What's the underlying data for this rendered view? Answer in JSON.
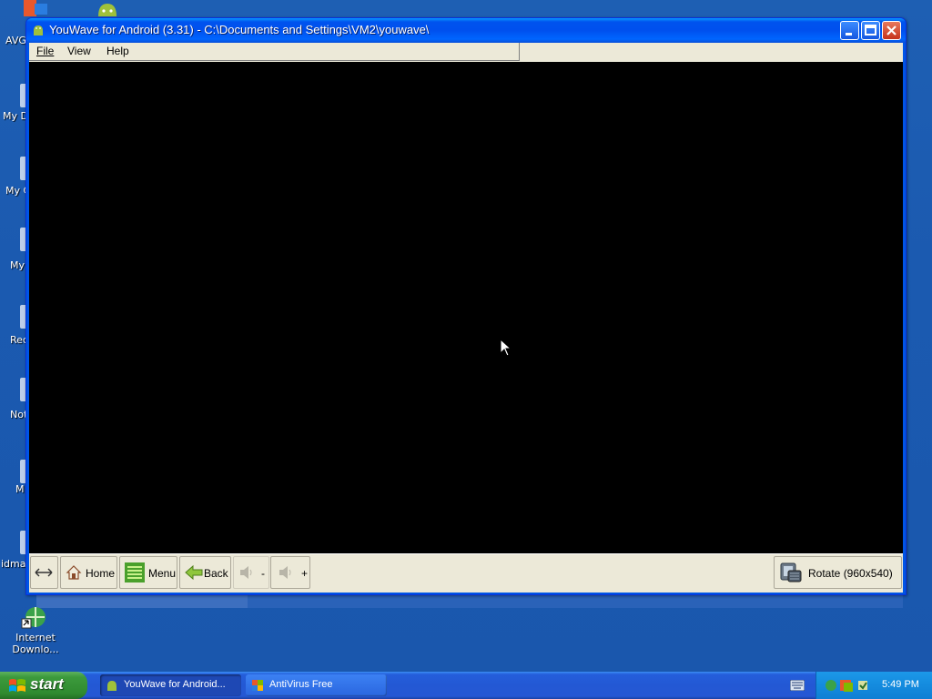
{
  "window": {
    "title": "YouWave for Android (3.31) - C:\\Documents and Settings\\VM2\\youwave\\",
    "menu": [
      "File",
      "View",
      "Help"
    ]
  },
  "toolbar": {
    "home_label": "Home",
    "menu_label": "Menu",
    "back_label": "Back",
    "vol_down_label": "-",
    "vol_up_label": "+",
    "rotate_label": "Rotate (960x540)"
  },
  "desktop": {
    "left_labels": [
      "AVG",
      "My D",
      "My C",
      "My",
      "Rec",
      "Not",
      "M",
      "idmar"
    ],
    "internet_download_label_1": "Internet",
    "internet_download_label_2": "Downlo..."
  },
  "taskbar": {
    "start_label": "start",
    "tasks": [
      "YouWave for Android...",
      "AntiVirus Free"
    ],
    "clock": "5:49 PM"
  },
  "icons": {
    "app": "android-icon",
    "home": "home-icon",
    "menu": "menu-list-icon",
    "back": "back-arrow-icon",
    "volume": "speaker-icon",
    "rotate": "rotate-device-icon",
    "resize": "resize-arrows-icon"
  },
  "colors": {
    "desktop_bg": "#1e5fb3",
    "titlebar": "#0053ee",
    "screen": "#000000",
    "taskbar": "#245edb",
    "start": "#3c9a3c",
    "tray": "#148bde"
  }
}
